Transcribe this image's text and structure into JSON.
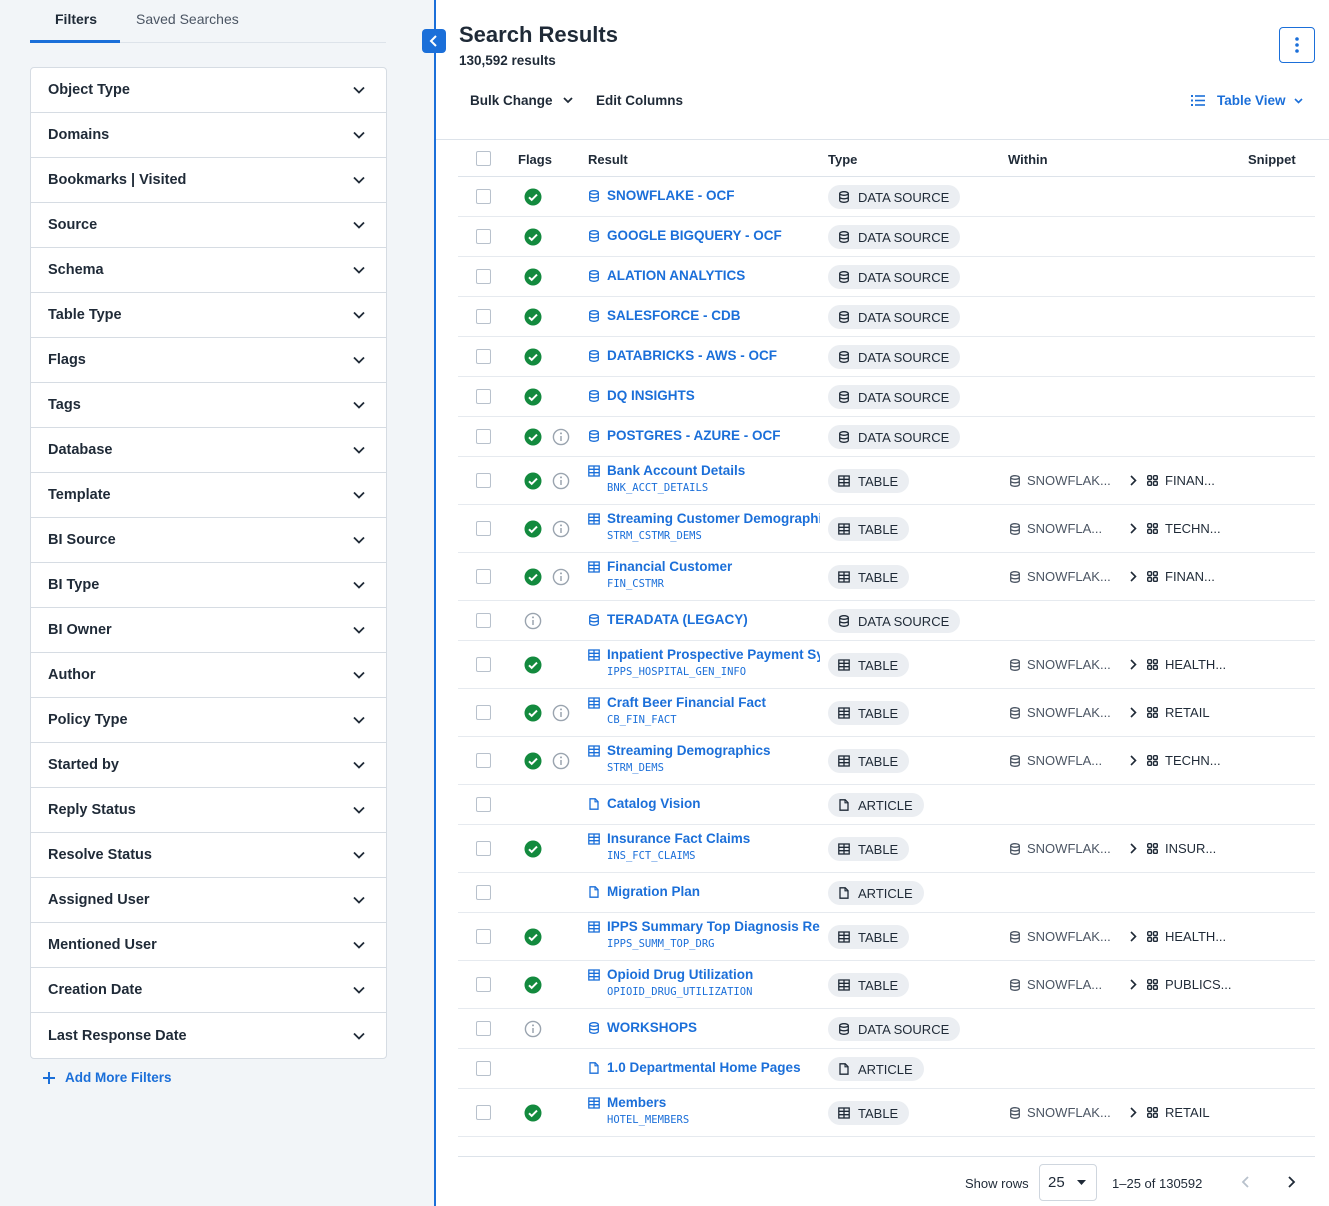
{
  "sidebar": {
    "tabs": [
      {
        "label": "Filters"
      },
      {
        "label": "Saved Searches"
      }
    ],
    "filters": [
      "Object Type",
      "Domains",
      "Bookmarks | Visited",
      "Source",
      "Schema",
      "Table Type",
      "Flags",
      "Tags",
      "Database",
      "Template",
      "BI Source",
      "BI Type",
      "BI Owner",
      "Author",
      "Policy Type",
      "Started by",
      "Reply Status",
      "Resolve Status",
      "Assigned User",
      "Mentioned User",
      "Creation Date",
      "Last Response Date"
    ],
    "add_more_filters": "Add More Filters"
  },
  "main": {
    "title": "Search Results",
    "result_count": "130,592 results",
    "toolbar": {
      "bulk_change": "Bulk Change",
      "edit_columns": "Edit Columns",
      "table_view": "Table View"
    },
    "columns": {
      "flags": "Flags",
      "result": "Result",
      "type": "Type",
      "within": "Within",
      "snippet": "Snippet"
    },
    "rows": [
      {
        "name": "SNOWFLAKE - OCF",
        "icon": "datasource",
        "check": true,
        "info": false,
        "type": "DATA SOURCE"
      },
      {
        "name": "GOOGLE BIGQUERY - OCF",
        "icon": "datasource",
        "check": true,
        "info": false,
        "type": "DATA SOURCE"
      },
      {
        "name": "ALATION ANALYTICS",
        "icon": "datasource",
        "check": true,
        "info": false,
        "type": "DATA SOURCE"
      },
      {
        "name": "SALESFORCE - CDB",
        "icon": "datasource",
        "check": true,
        "info": false,
        "type": "DATA SOURCE"
      },
      {
        "name": "DATABRICKS - AWS - OCF",
        "icon": "datasource",
        "check": true,
        "info": false,
        "type": "DATA SOURCE"
      },
      {
        "name": "DQ INSIGHTS",
        "icon": "datasource",
        "check": true,
        "info": false,
        "type": "DATA SOURCE"
      },
      {
        "name": "POSTGRES - AZURE - OCF",
        "icon": "datasource",
        "check": true,
        "info": true,
        "type": "DATA SOURCE"
      },
      {
        "name": "Bank Account Details",
        "sub": "BNK_ACCT_DETAILS",
        "icon": "table",
        "check": true,
        "info": true,
        "type": "TABLE",
        "within_db": "SNOWFLAK...",
        "within_schema": "FINAN..."
      },
      {
        "name": "Streaming Customer Demographics",
        "sub": "STRM_CSTMR_DEMS",
        "icon": "table",
        "check": true,
        "info": true,
        "type": "TABLE",
        "within_db": "SNOWFLA...",
        "within_schema": "TECHN..."
      },
      {
        "name": "Financial Customer",
        "sub": "FIN_CSTMR",
        "icon": "table",
        "check": true,
        "info": true,
        "type": "TABLE",
        "within_db": "SNOWFLAK...",
        "within_schema": "FINAN..."
      },
      {
        "name": "TERADATA (LEGACY)",
        "icon": "datasource",
        "check": false,
        "info": true,
        "info_first": true,
        "type": "DATA SOURCE"
      },
      {
        "name": "Inpatient Prospective Payment System",
        "sub": "IPPS_HOSPITAL_GEN_INFO",
        "icon": "table",
        "check": true,
        "info": false,
        "type": "TABLE",
        "within_db": "SNOWFLAK...",
        "within_schema": "HEALTH..."
      },
      {
        "name": "Craft Beer Financial Fact",
        "sub": "CB_FIN_FACT",
        "icon": "table",
        "check": true,
        "info": true,
        "type": "TABLE",
        "within_db": "SNOWFLAK...",
        "within_schema": "RETAIL"
      },
      {
        "name": "Streaming Demographics",
        "sub": "STRM_DEMS",
        "icon": "table",
        "check": true,
        "info": true,
        "type": "TABLE",
        "within_db": "SNOWFLA...",
        "within_schema": "TECHN..."
      },
      {
        "name": "Catalog Vision",
        "icon": "article",
        "check": false,
        "info": false,
        "type": "ARTICLE"
      },
      {
        "name": "Insurance Fact Claims",
        "sub": "INS_FCT_CLAIMS",
        "icon": "table",
        "check": true,
        "info": false,
        "type": "TABLE",
        "within_db": "SNOWFLAK...",
        "within_schema": "INSUR..."
      },
      {
        "name": "Migration Plan",
        "icon": "article",
        "check": false,
        "info": false,
        "type": "ARTICLE"
      },
      {
        "name": "IPPS Summary Top Diagnosis Related",
        "sub": "IPPS_SUMM_TOP_DRG",
        "icon": "table",
        "check": true,
        "info": false,
        "type": "TABLE",
        "within_db": "SNOWFLAK...",
        "within_schema": "HEALTH..."
      },
      {
        "name": "Opioid Drug Utilization",
        "sub": "OPIOID_DRUG_UTILIZATION",
        "icon": "table",
        "check": true,
        "info": false,
        "type": "TABLE",
        "within_db": "SNOWFLA...",
        "within_schema": "PUBLICS..."
      },
      {
        "name": "WORKSHOPS",
        "icon": "datasource",
        "check": false,
        "info": true,
        "info_first": true,
        "type": "DATA SOURCE"
      },
      {
        "name": "1.0 Departmental Home Pages",
        "icon": "article",
        "check": false,
        "info": false,
        "type": "ARTICLE"
      },
      {
        "name": "Members",
        "sub": "HOTEL_MEMBERS",
        "icon": "table",
        "check": true,
        "info": false,
        "type": "TABLE",
        "within_db": "SNOWFLAK...",
        "within_schema": "RETAIL"
      }
    ],
    "footer": {
      "show_rows_label": "Show rows",
      "rows_per_page": "25",
      "range": "1–25 of 130592"
    }
  },
  "colors": {
    "accent": "#1b6fd9",
    "success": "#138a3e",
    "pill_bg": "#ebeef2",
    "sidebar_bg": "#f2f5f8"
  }
}
